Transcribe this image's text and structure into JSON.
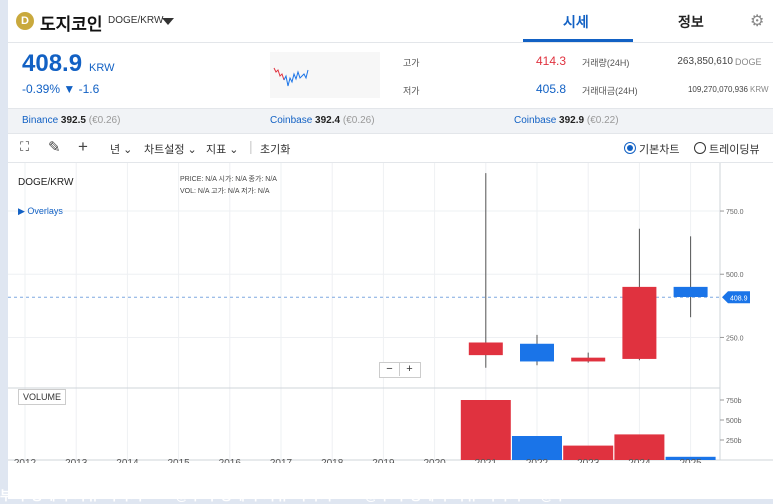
{
  "header": {
    "coin_logo": "D",
    "coin_name": "도지코인",
    "pair": "DOGE/KRW",
    "tab_quote": "시세",
    "tab_info": "정보",
    "settings_icon": "gear-icon"
  },
  "price": {
    "current": "408.9",
    "unit": "KRW",
    "change": "-0.39% ▼ -1.6"
  },
  "stats": {
    "high_label": "고가",
    "high_value": "414.3",
    "low_label": "저가",
    "low_value": "405.8",
    "vol_label": "거래량(24H)",
    "vol_value": "263,850,610",
    "vol_unit": "DOGE",
    "amount_label": "거래대금(24H)",
    "amount_value": "109,270,070,936",
    "amount_unit": "KRW"
  },
  "exchanges": [
    {
      "name": "Binance",
      "price": "392.5",
      "sub": "(€0.26)"
    },
    {
      "name": "Coinbase",
      "price": "392.4",
      "sub": "(€0.26)"
    },
    {
      "name": "Coinbase",
      "price": "392.9",
      "sub": "(€0.22)"
    }
  ],
  "toolbar": {
    "period": "년",
    "chart_settings": "차트설정",
    "indicators": "지표",
    "reset": "초기화",
    "basic_chart": "기본차트",
    "trading_view": "트레이딩뷰"
  },
  "chart_legend": {
    "pair": "DOGE/KRW",
    "overlays": "▶ Overlays",
    "ohlc_line1": "PRICE: N/A   시가: N/A   종가: N/A",
    "ohlc_line2": "VOL: N/A   고가: N/A   저가: N/A",
    "volume": "VOLUME",
    "zoom_out": "−",
    "zoom_in": "+"
  },
  "colors": {
    "up": "#e0323f",
    "down": "#1a74e8",
    "accent": "#1261c4"
  },
  "chart_data": {
    "type": "candlestick",
    "x": [
      "2012",
      "2013",
      "2014",
      "2015",
      "2016",
      "2017",
      "2018",
      "2019",
      "2020",
      "2021",
      "2022",
      "2023",
      "2024",
      "2025"
    ],
    "candles": [
      {
        "year": "2021",
        "open": 180,
        "close": 230,
        "high": 900,
        "low": 130,
        "dir": "up"
      },
      {
        "year": "2022",
        "open": 225,
        "close": 155,
        "high": 260,
        "low": 140,
        "dir": "down"
      },
      {
        "year": "2023",
        "open": 155,
        "close": 170,
        "high": 190,
        "low": 150,
        "dir": "up"
      },
      {
        "year": "2024",
        "open": 165,
        "close": 450,
        "high": 680,
        "low": 160,
        "dir": "up"
      },
      {
        "year": "2025",
        "open": 450,
        "close": 410,
        "high": 650,
        "low": 330,
        "dir": "down"
      }
    ],
    "volume": [
      {
        "year": "2021",
        "value": 750
      },
      {
        "year": "2022",
        "value": 300
      },
      {
        "year": "2023",
        "value": 180
      },
      {
        "year": "2024",
        "value": 320
      },
      {
        "year": "2025",
        "value": 40
      }
    ],
    "price_ticks": [
      "750.0",
      "500.0",
      "250.0"
    ],
    "volume_ticks": [
      "750b",
      "500b",
      "250b"
    ],
    "current_price_label": "408.9",
    "current_price": 408.9,
    "ylim": [
      50,
      940
    ],
    "vol_ylim": [
      0,
      900
    ]
  }
}
